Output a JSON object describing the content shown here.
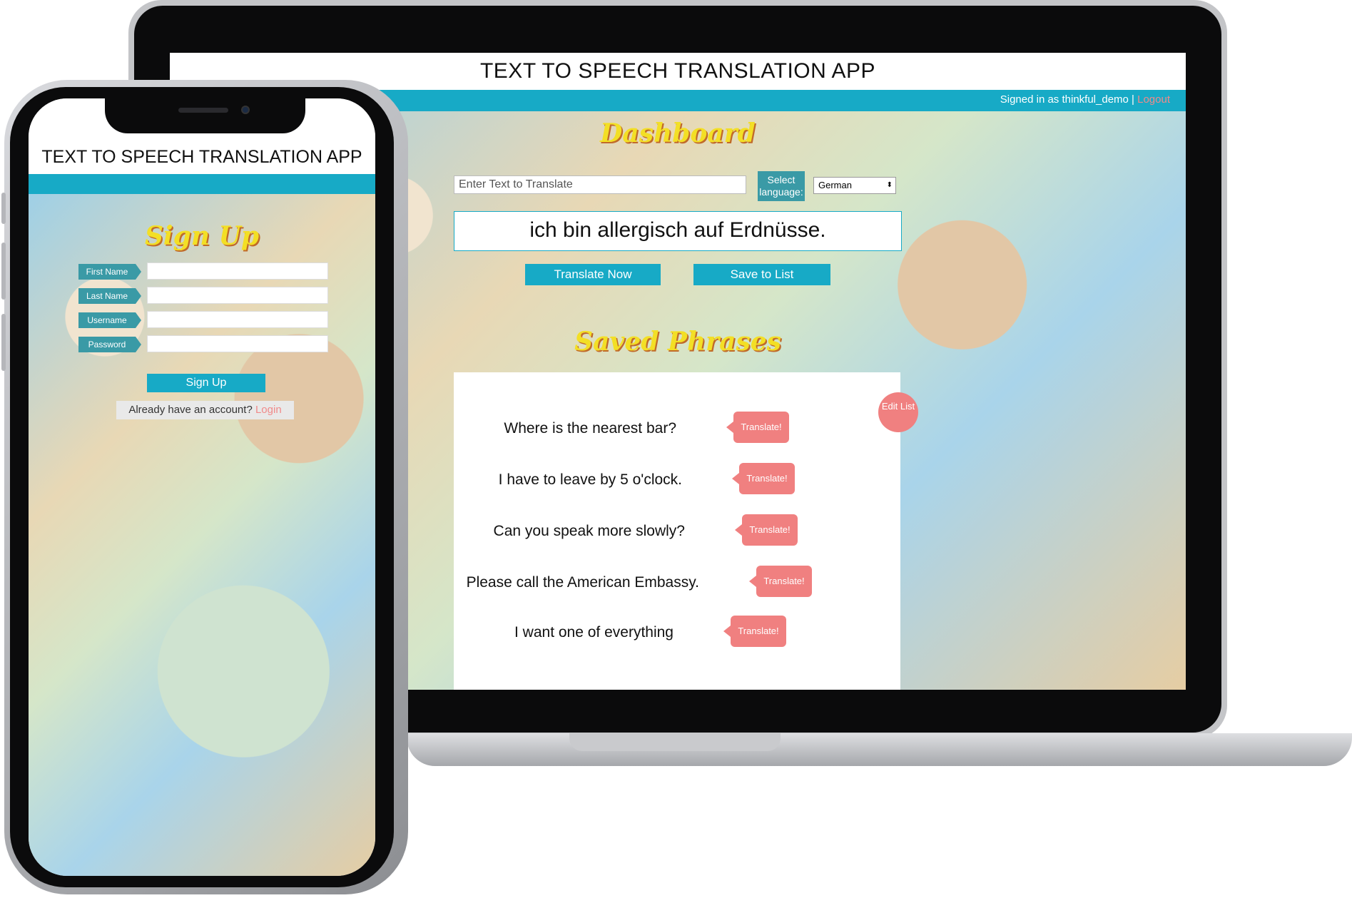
{
  "app": {
    "title": "TEXT TO SPEECH TRANSLATION APP"
  },
  "colors": {
    "teal": "#17aac6",
    "label_teal": "#3a9aa6",
    "accent_yellow": "#f3df25",
    "pill_pink": "#f08080"
  },
  "laptop": {
    "header": {
      "signed_in_text": "Signed in as thinkful_demo |",
      "logout_label": "Logout"
    },
    "dashboard": {
      "title": "Dashboard",
      "text_input_placeholder": "Enter Text to Translate",
      "language_label": "Select language:",
      "language_selected": "German",
      "translation_output": "ich bin allergisch auf Erdnüsse.",
      "translate_button": "Translate Now",
      "save_button": "Save to List"
    },
    "saved_phrases": {
      "title": "Saved Phrases",
      "edit_list_label": "Edit List",
      "items": [
        {
          "text": "Where is the nearest bar?",
          "button": "Translate!"
        },
        {
          "text": "I have to leave by 5 o'clock.",
          "button": "Translate!"
        },
        {
          "text": "Can you speak more slowly?",
          "button": "Translate!"
        },
        {
          "text": "Please call the American Embassy.",
          "button": "Translate!"
        },
        {
          "text": "I want one of everything",
          "button": "Translate!"
        }
      ]
    }
  },
  "phone": {
    "signup": {
      "title": "Sign Up",
      "fields": [
        {
          "label": "First Name"
        },
        {
          "label": "Last Name"
        },
        {
          "label": "Username"
        },
        {
          "label": "Password"
        }
      ],
      "submit_button": "Sign Up",
      "login_prompt": "Already have an account?",
      "login_link": "Login"
    }
  }
}
